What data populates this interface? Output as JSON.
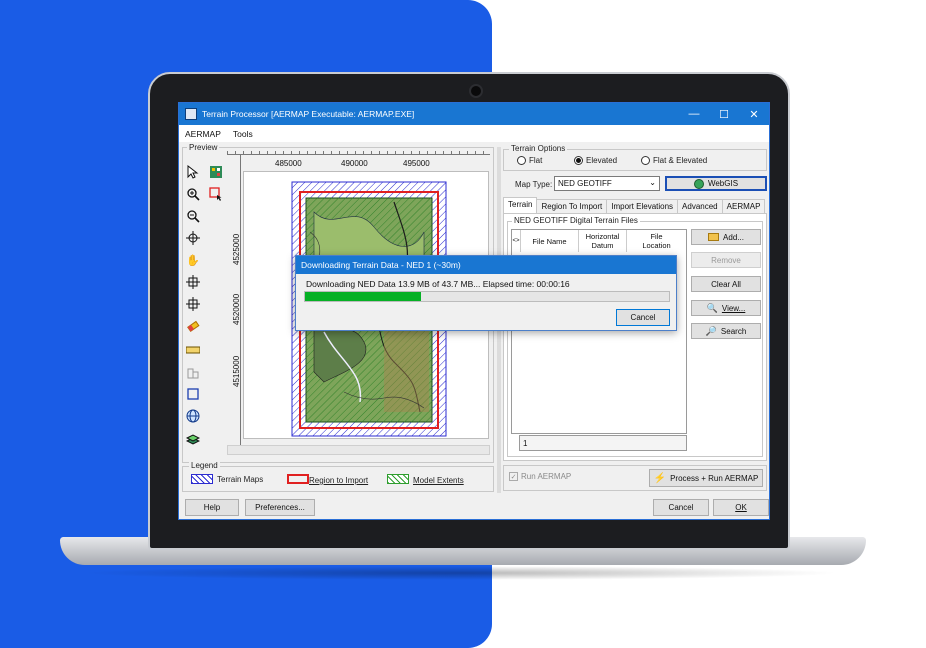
{
  "window": {
    "title": "Terrain Processor [AERMAP Executable: AERMAP.EXE]",
    "controls": [
      "—",
      "☐",
      "✕"
    ]
  },
  "menu": {
    "items": [
      "AERMAP",
      "Tools"
    ]
  },
  "preview": {
    "label": "Preview",
    "x_ticks": [
      "485000",
      "490000",
      "495000"
    ],
    "y_ticks": [
      "4525000",
      "4520000",
      "4515000"
    ]
  },
  "legend": {
    "label": "Legend",
    "items": [
      {
        "label": "Terrain Maps",
        "color": "#2b2bd0"
      },
      {
        "label": "Region to Import",
        "color": "#e02020"
      },
      {
        "label": "Model Extents",
        "color": "#2e9e2e"
      }
    ]
  },
  "terrain_options": {
    "label": "Terrain Options",
    "radios": [
      {
        "label": "Flat",
        "selected": false
      },
      {
        "label": "Elevated",
        "selected": true
      },
      {
        "label": "Flat & Elevated",
        "selected": false
      }
    ],
    "map_type_label": "Map Type:",
    "map_type_value": "NED GEOTIFF",
    "webgis_label": "WebGIS"
  },
  "tabs": [
    "Terrain",
    "Region To Import",
    "Import Elevations",
    "Advanced",
    "AERMAP"
  ],
  "files": {
    "group_label": "NED GEOTIFF Digital Terrain Files",
    "columns": [
      "<>",
      "File Name",
      "Horizontal Datum",
      "File Location"
    ],
    "counter": "1",
    "buttons": {
      "add": "Add...",
      "remove": "Remove",
      "clear": "Clear All",
      "view": "View...",
      "search": "Search"
    }
  },
  "run": {
    "checkbox_label": "Run AERMAP",
    "process_label": "Process + Run AERMAP"
  },
  "bottom": {
    "help": "Help",
    "preferences": "Preferences...",
    "cancel": "Cancel",
    "ok": "OK"
  },
  "dialog": {
    "title": "Downloading Terrain Data - NED 1 (~30m)",
    "message": "Downloading NED Data 13.9 MB of 43.7 MB... Elapsed time: 00:00:16",
    "progress": 0.318,
    "cancel": "Cancel"
  }
}
